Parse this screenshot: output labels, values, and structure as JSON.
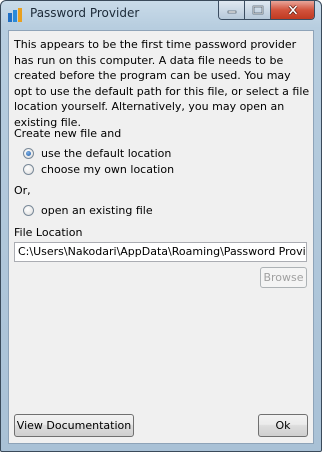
{
  "window": {
    "title": "Password Provider",
    "icon": "app-logo-icon",
    "caption_icons": [
      "minimize-icon",
      "maximize-icon",
      "close-icon"
    ]
  },
  "intro_text": "This appears to be the first time password provider has run on this computer. A data file needs to be created before the program can be used. You may opt to use the default path for this file, or select a file location yourself. Alternatively, you may open an existing file.",
  "create_group": {
    "label": "Create new file and",
    "options": [
      {
        "label": "use the default location",
        "checked": true
      },
      {
        "label": "choose my own location",
        "checked": false
      }
    ]
  },
  "or_label": "Or,",
  "open_option": {
    "label": "open an existing file",
    "checked": false
  },
  "file_location": {
    "label": "File Location",
    "value": "C:\\Users\\Nakodari\\AppData\\Roaming\\Password Provider"
  },
  "buttons": {
    "browse": "Browse",
    "view_documentation": "View Documentation",
    "ok": "Ok"
  },
  "colors": {
    "frame": "#b7cddf",
    "client": "#f0f0f0",
    "close_button": "#c9452c",
    "radio_selected": "#1e5aa8"
  }
}
